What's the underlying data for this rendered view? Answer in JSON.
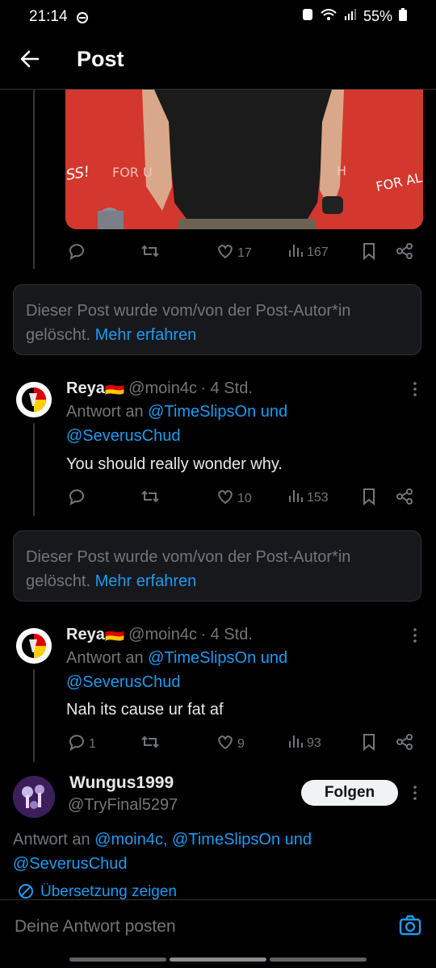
{
  "status_bar": {
    "time": "21:14",
    "battery": "55%"
  },
  "header": {
    "title": "Post"
  },
  "first_post_actions": {
    "likes": "17",
    "views": "167"
  },
  "deleted_notice": {
    "text": "Dieser Post wurde vom/von der Post-Autor*in gelöscht.",
    "link": "Mehr erfahren"
  },
  "replies": [
    {
      "name": "Reya🇩🇪",
      "handle": "@moin4c",
      "time": "· 4 Std.",
      "reply_prefix": "Antwort an",
      "reply_to_1": "@TimeSlipsOn und",
      "reply_to_2": "@SeverusChud",
      "text": "You should really wonder why.",
      "comments": "",
      "likes": "10",
      "views": "153"
    },
    {
      "name": "Reya🇩🇪",
      "handle": "@moin4c",
      "time": "· 4 Std.",
      "reply_prefix": "Antwort an",
      "reply_to_1": "@TimeSlipsOn und",
      "reply_to_2": "@SeverusChud",
      "text": "Nah its cause ur fat af",
      "comments": "1",
      "likes": "9",
      "views": "93"
    }
  ],
  "focused": {
    "name": "Wungus1999",
    "handle": "@TryFinal5297",
    "follow_label": "Folgen",
    "reply_prefix": "Antwort an",
    "reply_to_1": "@moin4c, @TimeSlipsOn und",
    "reply_to_2": "@SeverusChud",
    "translate": "Übersetzung zeigen"
  },
  "composer": {
    "placeholder": "Deine Antwort posten"
  },
  "colors": {
    "accent": "#1d9bf0",
    "background": "#000000",
    "muted": "#71767b"
  }
}
